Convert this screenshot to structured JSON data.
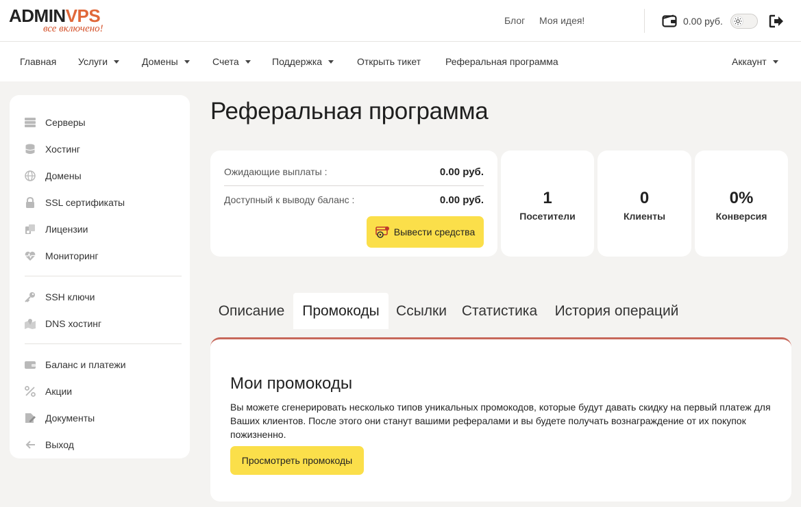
{
  "header": {
    "logo_text_main": "ADMIN",
    "logo_text_accent": "VPS",
    "logo_slogan": "все включено!",
    "links": [
      "Блог",
      "Моя идея!"
    ],
    "balance": "0.00 руб."
  },
  "nav": {
    "items": [
      {
        "label": "Главная",
        "dropdown": false
      },
      {
        "label": "Услуги",
        "dropdown": true
      },
      {
        "label": "Домены",
        "dropdown": true
      },
      {
        "label": "Счета",
        "dropdown": true
      },
      {
        "label": "Поддержка",
        "dropdown": true
      },
      {
        "label": "Открыть тикет",
        "dropdown": false
      },
      {
        "label": "Реферальная программа",
        "dropdown": false
      }
    ],
    "account": "Аккаунт"
  },
  "sidebar": {
    "items": [
      {
        "label": "Серверы",
        "icon": "server-icon"
      },
      {
        "label": "Хостинг",
        "icon": "database-icon"
      },
      {
        "label": "Домены",
        "icon": "globe-icon"
      },
      {
        "label": "SSL сертификаты",
        "icon": "lock-icon"
      },
      {
        "label": "Лицензии",
        "icon": "license-icon"
      },
      {
        "label": "Мониторинг",
        "icon": "heartbeat-icon"
      },
      {
        "label": "SSH ключи",
        "icon": "key-icon"
      },
      {
        "label": "DNS хостинг",
        "icon": "map-icon"
      },
      {
        "label": "Баланс и платежи",
        "icon": "wallet-icon"
      },
      {
        "label": "Акции",
        "icon": "percent-icon"
      },
      {
        "label": "Документы",
        "icon": "document-icon"
      },
      {
        "label": "Выход",
        "icon": "arrow-left-icon"
      }
    ]
  },
  "main": {
    "title": "Реферальная программа",
    "payouts": {
      "pending_label": "Ожидающие выплаты :",
      "pending_value": "0.00 руб.",
      "available_label": "Доступный к выводу баланс :",
      "available_value": "0.00 руб.",
      "withdraw_button": "Вывести средства"
    },
    "stats": [
      {
        "value": "1",
        "label": "Посетители"
      },
      {
        "value": "0",
        "label": "Клиенты"
      },
      {
        "value": "0%",
        "label": "Конверсия"
      }
    ],
    "tabs": [
      {
        "label": "Описание",
        "active": false
      },
      {
        "label": "Промокоды",
        "active": true
      },
      {
        "label": "Ссылки",
        "active": false
      },
      {
        "label": "Статистика",
        "active": false
      },
      {
        "label": "История операций",
        "active": false
      }
    ],
    "promo": {
      "title": "Мои промокоды",
      "text": "Вы можете сгенерировать несколько типов уникальных промокодов, которые будут давать скидку на первый платеж для Ваших клиентов. После этого они станут вашими рефералами и вы будете получать вознаграждение от их покупок пожизненно.",
      "button": "Просмотреть промокоды"
    }
  },
  "colors": {
    "accent_yellow": "#fbdf4a",
    "logo_orange": "#e0683a",
    "tab_border": "#c7675a"
  }
}
